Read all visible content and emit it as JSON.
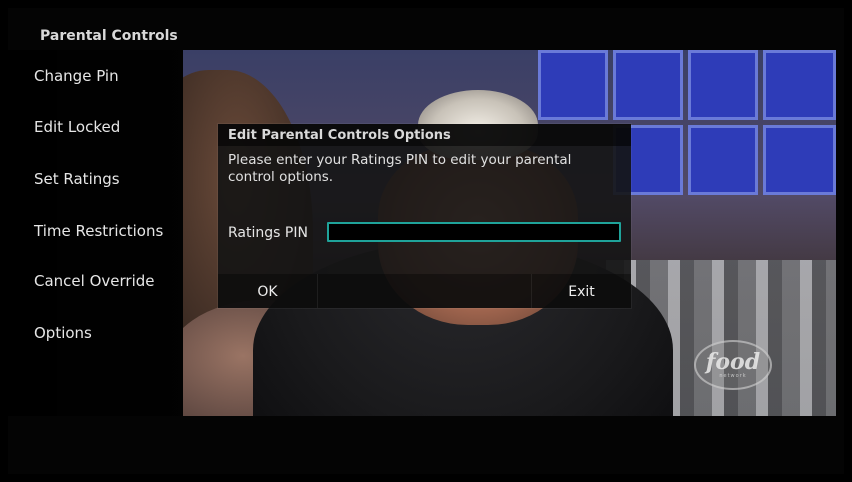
{
  "menu": {
    "title": "Parental Controls",
    "items": [
      {
        "label": "Change Pin"
      },
      {
        "label": "Edit Locked"
      },
      {
        "label": "Set Ratings"
      },
      {
        "label": "Time Restrictions"
      },
      {
        "label": "Cancel Override"
      },
      {
        "label": "Options"
      }
    ]
  },
  "dialog": {
    "title": "Edit Parental Controls Options",
    "message": "Please enter your Ratings PIN to edit your parental control options.",
    "pin_label": "Ratings PIN",
    "pin_value": "",
    "ok_label": "OK",
    "exit_label": "Exit",
    "input_border_color": "#1fa39a"
  },
  "channel_logo": {
    "word": "food",
    "sub": "network",
    "icon": "food-network-logo-icon"
  }
}
